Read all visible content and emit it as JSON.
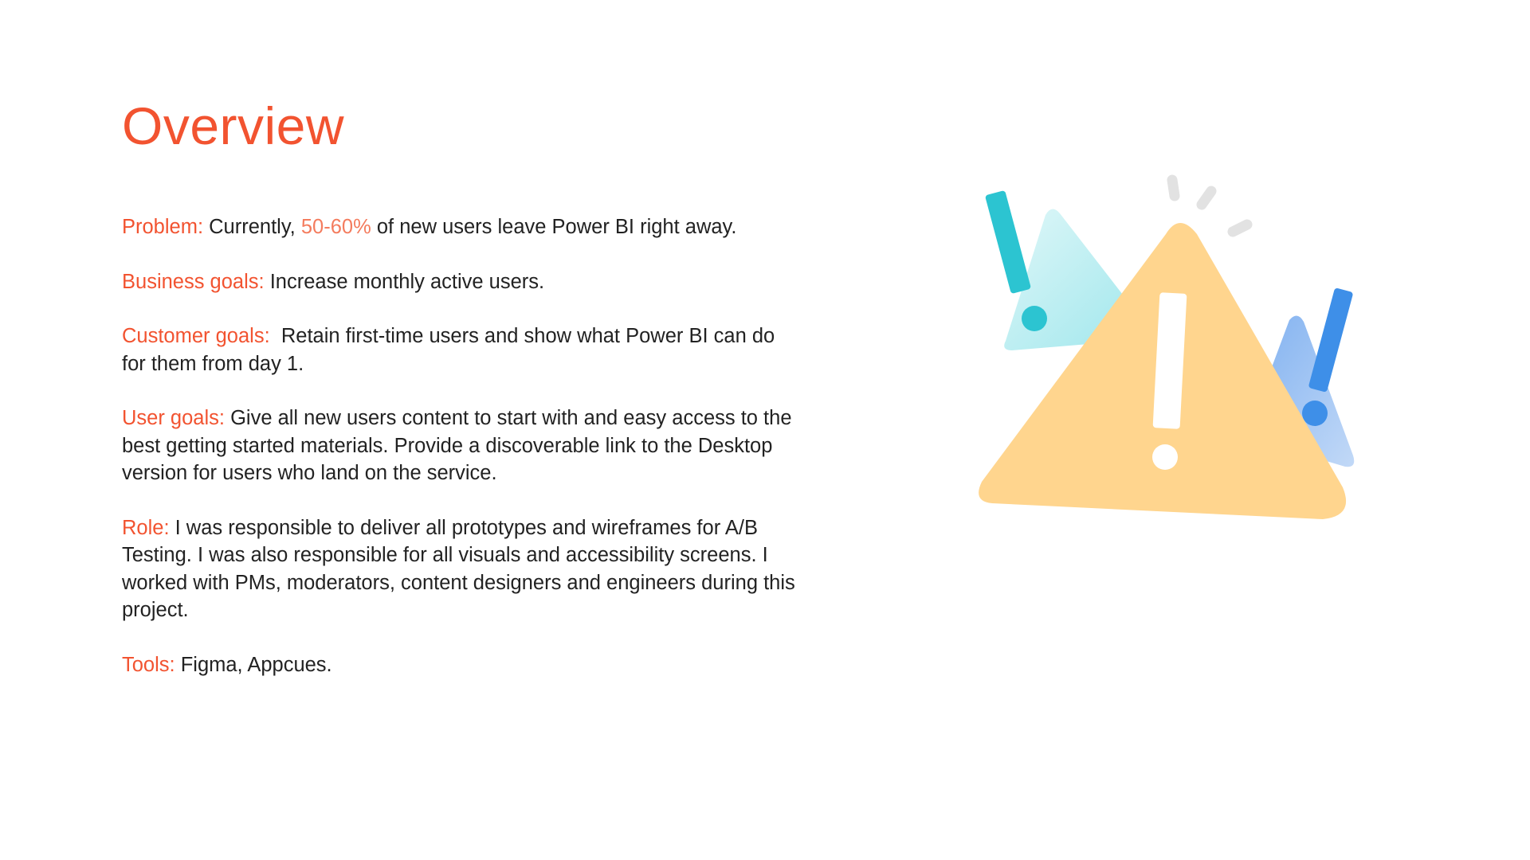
{
  "page": {
    "title": "Overview"
  },
  "sections": {
    "problem": {
      "label": "Problem:",
      "text_before": " Currently, ",
      "highlight": "50-60%",
      "text_after": " of new users leave Power BI right away."
    },
    "business_goals": {
      "label": "Business goals:",
      "text": " Increase monthly active users."
    },
    "customer_goals": {
      "label": "Customer goals:",
      "text": "  Retain first-time users and show what Power BI can do for them from day 1."
    },
    "user_goals": {
      "label": "User goals:",
      "text": " Give all new users content to start with and easy access to the best getting started materials. Provide a discoverable link to the Desktop version for users who land on the service."
    },
    "role": {
      "label": "Role:",
      "text": " I was responsible to deliver all prototypes and wireframes for A/B Testing. I was also responsible for all visuals and accessibility screens. I worked with PMs, moderators, content designers and engineers during this project."
    },
    "tools": {
      "label": "Tools:",
      "text": " Figma, Appcues."
    }
  },
  "illustration": {
    "icon": "warning-triangle-icon",
    "colors": {
      "main_triangle": "#ffd58e",
      "left_triangle": "#bdeff2",
      "left_exclamation": "#2cc4d1",
      "right_triangle": "#a9c9f5",
      "right_exclamation": "#3e8fe8",
      "spark": "#e2e2e2"
    }
  }
}
